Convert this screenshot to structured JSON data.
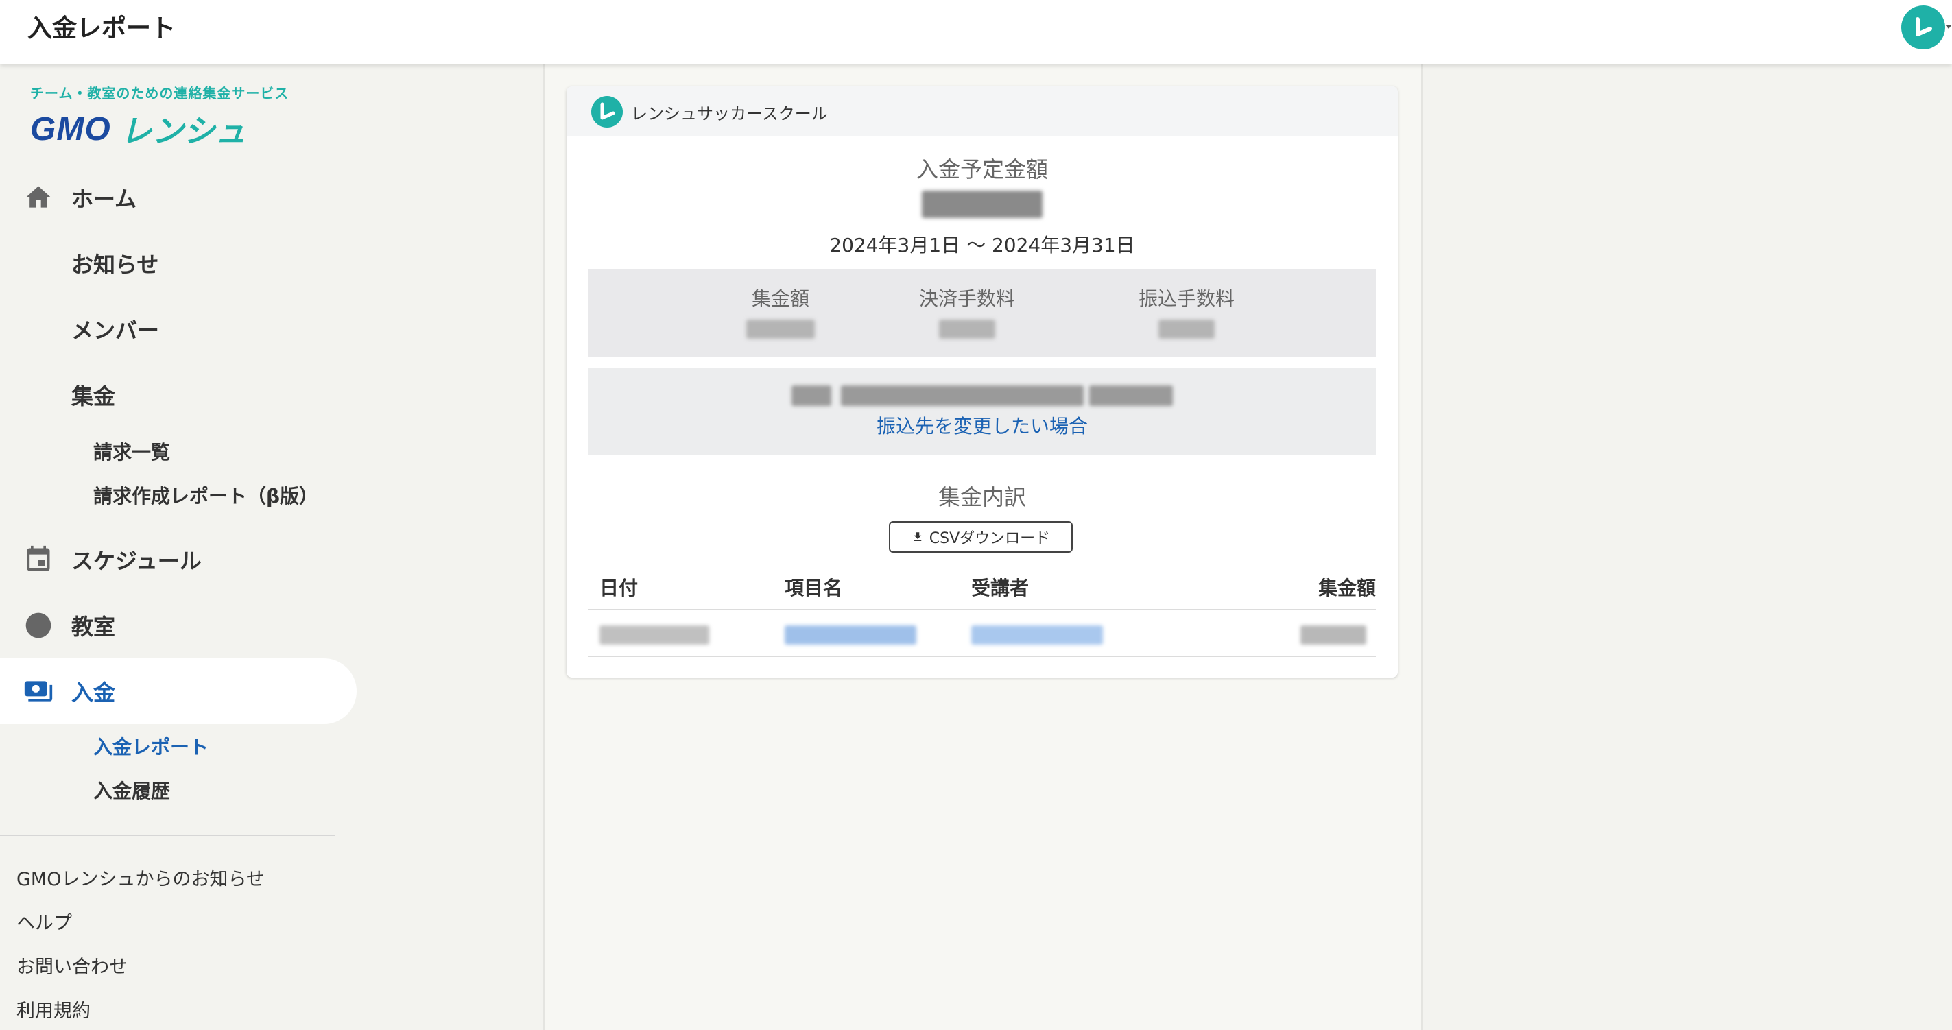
{
  "header": {
    "title": "入金レポート"
  },
  "logo": {
    "tagline": "チーム・教室のための連絡集金サービス",
    "gmo": "GMO",
    "brand": "レンシュ"
  },
  "nav": {
    "home": "ホーム",
    "news": "お知らせ",
    "members": "メンバー",
    "collection": "集金",
    "collection_sub": [
      "請求一覧",
      "請求作成レポート（β版）"
    ],
    "schedule": "スケジュール",
    "classroom": "教室",
    "deposit": "入金",
    "deposit_sub": [
      "入金レポート",
      "入金履歴"
    ]
  },
  "footer_links": [
    "GMOレンシュからのお知らせ",
    "ヘルプ",
    "お問い合わせ",
    "利用規約"
  ],
  "card": {
    "org_name": "レンシュサッカースクール",
    "scheduled_label": "入金予定金額",
    "period": "2024年3月1日 〜 2024年3月31日",
    "summary": {
      "collected_label": "集金額",
      "payment_fee_label": "決済手数料",
      "transfer_fee_label": "振込手数料"
    },
    "change_account_link": "振込先を変更したい場合",
    "breakdown_title": "集金内訳",
    "csv_button": "CSVダウンロード",
    "table": {
      "columns": [
        "日付",
        "項目名",
        "受講者",
        "集金額"
      ]
    }
  },
  "colors": {
    "accent": "#1fb1a7",
    "primary": "#1b62b3",
    "brand_navy": "#1b4aa0"
  }
}
